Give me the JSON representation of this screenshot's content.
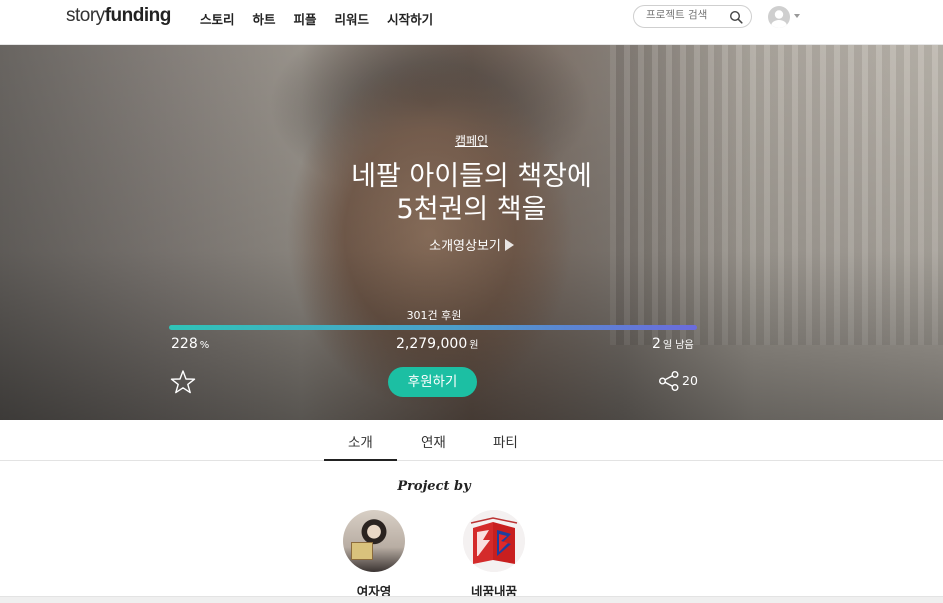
{
  "header": {
    "logo_light": "story",
    "logo_bold": "funding",
    "nav": [
      "스토리",
      "하트",
      "피플",
      "리워드",
      "시작하기"
    ],
    "search_placeholder": "프로젝트 검색"
  },
  "hero": {
    "category": "캠페인",
    "title_line1": "네팔 아이들의 책장에",
    "title_line2": "5천권의 책을",
    "video_link": "소개영상보기",
    "backers": "301건 후원",
    "progress_percent": 100,
    "percent_value": "228",
    "percent_unit": "%",
    "amount_value": "2,279,000",
    "amount_unit": "원",
    "days_value": "2",
    "days_unit": "일 남음",
    "fund_button": "후원하기",
    "share_count": "20"
  },
  "tabs": [
    "소개",
    "연재",
    "파티"
  ],
  "project_by": {
    "label": "Project by",
    "creators": [
      {
        "name": "여자영"
      },
      {
        "name": "네꿈내꿈"
      }
    ]
  }
}
